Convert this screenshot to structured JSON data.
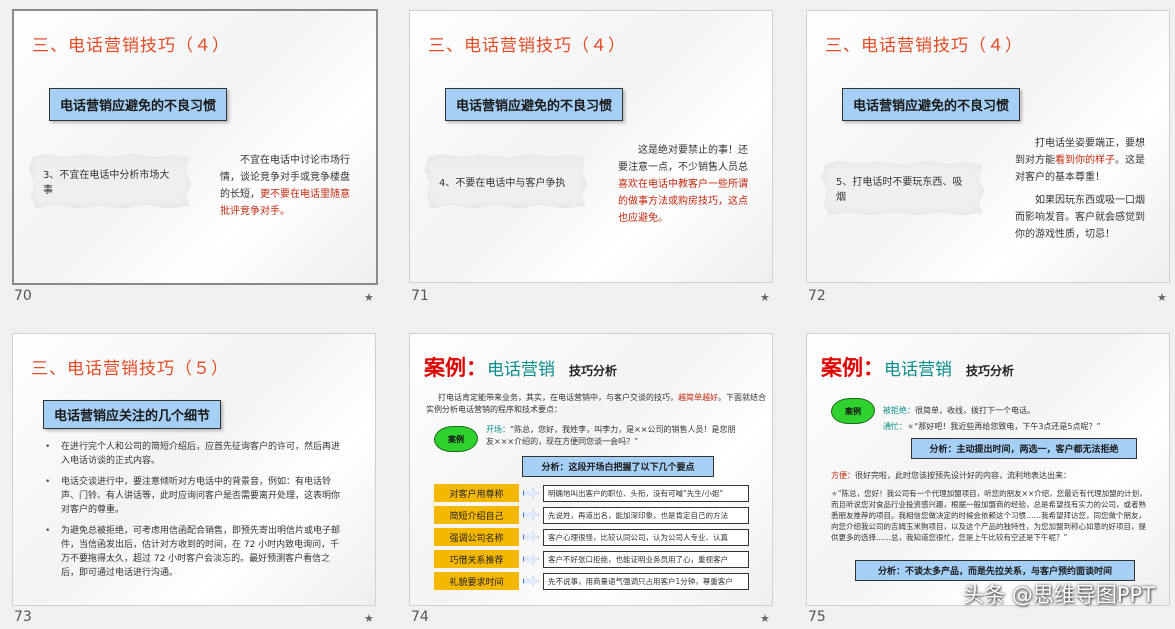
{
  "slides": [
    {
      "number": "70",
      "title": "三、电话营销技巧（４）",
      "subtitle": "电话营销应避免的不良习惯",
      "torn_text": "3、不宜在电话中分析市场大事",
      "desc_plain": "不宜在电话中讨论市场行情，谈论竞争对手或竞争楼盘的长短，",
      "desc_red": "更不要在电话里随意批评竞争对手。"
    },
    {
      "number": "71",
      "title": "三、电话营销技巧（４）",
      "subtitle": "电话营销应避免的不良习惯",
      "torn_text": "4、不要在电话中与客户争执",
      "desc_plain": "这是绝对要禁止的事！还要注意一点，不少销售人员总",
      "desc_red": "喜欢在电话中教客户一些所谓的做事方法或购房技巧，这点也应避免。"
    },
    {
      "number": "72",
      "title": "三、电话营销技巧（４）",
      "subtitle": "电话营销应避免的不良习惯",
      "torn_text": "5、打电话时不要玩东西、吸烟",
      "desc_p1_a": "打电话坐姿要端正，要想到对方能",
      "desc_p1_red": "看到你的样子",
      "desc_p1_b": "。这是对客户的基本尊重！",
      "desc_p2": "如果因玩东西或吸一口烟而影响发音。客户就会感觉到你的游戏性质，切忌！"
    },
    {
      "number": "73",
      "title": "三、电话营销技巧（５）",
      "subtitle": "电话营销应关注的几个细节",
      "bullets": [
        "在进行完个人和公司的简短介绍后，应首先征询客户的许可，然后再进入电话访谈的正式内容。",
        "电话交谈进行中，要注意倾听对方电话中的背景音，例如：有电话铃声、门铃、有人讲话等，此时应询问客户是否需要离开处理，这表明你对客户的尊重。",
        "为避免总被拒绝，可考虑用信函配合销售，即预先寄出明信片或电子邮件，当信函发出后，估计对方收到的时间，在 72 小时内致电询问，千万不要拖得太久，超过 72 小时客户会淡忘的。最好预测客户看信之后，即可通过电话进行沟通。"
      ]
    },
    {
      "number": "74",
      "case_label": "案例",
      "colon": "：",
      "topic": "电话营销",
      "skill": "技巧分析",
      "intro_plain": "打电话肯定能带来业务，其实，在电话营销中，与客户交谈的技巧，",
      "intro_red": "越简单越好",
      "intro_tail": "。下面就结合实例分析电话营销的程序和技术要点：",
      "cloud": "案例",
      "opening_label": "开场：",
      "opening_text": "“陈总，您好，我姓李，叫李力，是××公司的销售人员！是您朋友×××介绍的，现在方便同您谈一会吗？”",
      "analysis": "分析：这段开场白把握了以下几个要点",
      "tips": [
        {
          "label": "对客户用尊称",
          "desc": "明确地叫出客户的职位、头衔，没有可喊“先生/小姐”"
        },
        {
          "label": "简短介绍自己",
          "desc": "先说姓，再道出名，能加深印象，也是肯定自己的方法"
        },
        {
          "label": "强调公司名称",
          "desc": "客户心理很怪，比较认同公司，认为公司人专业、认真"
        },
        {
          "label": "巧借关系推荐",
          "desc": "客户不好张口拒绝，也能证明业务员用了心，重视客户"
        },
        {
          "label": "礼貌要求时间",
          "desc": "先不说事，用商量语气强调只占用客户1分钟，尊重客户"
        }
      ]
    },
    {
      "number": "75",
      "case_label": "案例",
      "colon": "：",
      "topic": "电话营销",
      "skill": "技巧分析",
      "cloud": "案例",
      "refuse_label": "被拒绝：",
      "refuse_text": "很简单，收线，拨打下一个电话。",
      "accept_label": "通忙：",
      "accept_text": "“那好吧！我近些再给您致电，下午3点还是5点呢？”",
      "analysis1": "分析：主动提出时间，两选一，客户都无法拒绝",
      "convenient_label": "方便：",
      "convenient_text": "很好完啦，此时您该按预先设计好的内容，流利地表达出来：",
      "pitch": "“陈总，您好！我公司有一个代理加盟项目，听您的朋友××介绍，您最近有代理加盟的计划，而且听说您对食品行业投资感兴趣，根据一般加盟商的经验，总是希望找有实力的公司，或者熟悉朋友推荐的项目。我相信您做决定的时候会依赖这个习惯……我希望拜访您，同您做个朋友，向您介绍我公司的吉姆玉米狗项目，以及这个产品的独特性，为您加盟到称心如意的好项目，提供更多的选择……总，我知道您很忙，您是上午比较有空还是下午呢？”",
      "analysis2": "分析：不谈太多产品，而是先拉关系，与客户预约面谈时间"
    }
  ],
  "star": "★",
  "watermark": "头条 @思维导图PPT"
}
